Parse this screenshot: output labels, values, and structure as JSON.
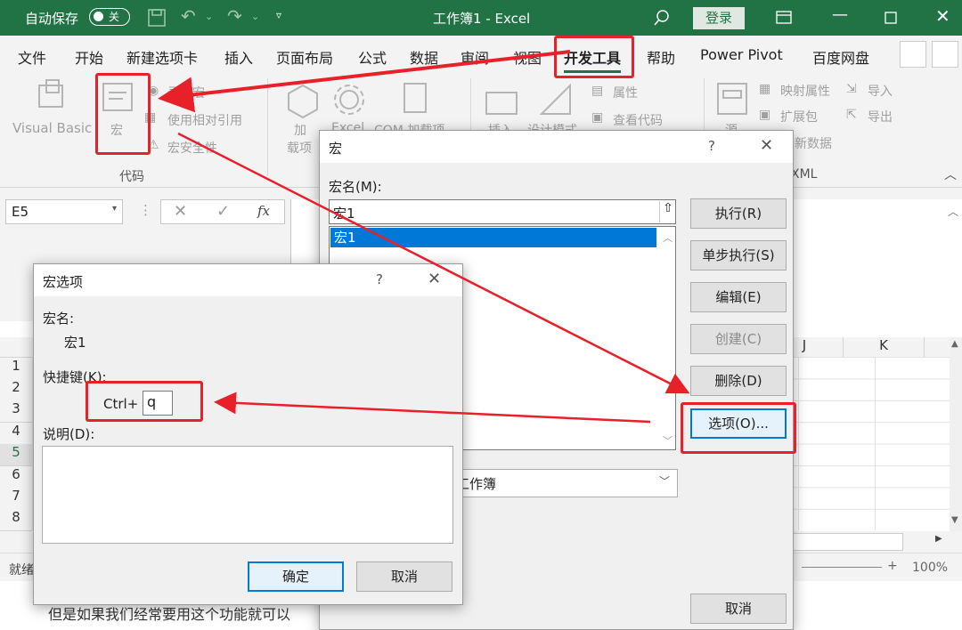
{
  "title_bar": {
    "autosave_label": "自动保存",
    "autosave_state": "关",
    "window_title": "工作簿1  -  Excel",
    "login_label": "登录"
  },
  "tabs": [
    "文件",
    "开始",
    "新建选项卡",
    "插入",
    "页面布局",
    "公式",
    "数据",
    "审阅",
    "视图",
    "开发工具",
    "帮助",
    "Power Pivot",
    "百度网盘"
  ],
  "active_tab": "开发工具",
  "ribbon": {
    "code_group": {
      "visual_basic": "Visual Basic",
      "macros": "宏",
      "record_macro": "录制宏",
      "relative_ref": "使用相对引用",
      "macro_security": "宏安全性",
      "group_label": "代码"
    },
    "addins": {
      "add": "加",
      "add2": "载项",
      "excel": "Excel",
      "com": "COM 加载项"
    },
    "controls": {
      "insert": "插入",
      "design": "设计模式",
      "properties": "属性",
      "view_code": "查看代码"
    },
    "xml": {
      "source": "源",
      "map_props": "映射属性",
      "expansion": "扩展包",
      "refresh": "新数据",
      "import": "导入",
      "export": "导出",
      "group_tail": "XML"
    }
  },
  "formula_bar": {
    "name_box": "E5",
    "fx": "fx"
  },
  "grid": {
    "rows": [
      "1",
      "2",
      "3",
      "4",
      "5",
      "6",
      "7",
      "8"
    ],
    "cols_visible": [
      "J",
      "K"
    ],
    "status_left": "就绪",
    "zoom": "100%"
  },
  "macro_dialog": {
    "title": "宏",
    "help": "?",
    "name_label": "宏名(M):",
    "name_value": "宏1",
    "list": [
      "宏1"
    ],
    "location_value": "工作簿",
    "buttons": {
      "run": "执行(R)",
      "step": "单步执行(S)",
      "edit": "编辑(E)",
      "create": "创建(C)",
      "delete": "删除(D)",
      "options": "选项(O)...",
      "cancel": "取消"
    }
  },
  "options_dialog": {
    "title": "宏选项",
    "help": "?",
    "name_label": "宏名:",
    "name_value": "宏1",
    "shortcut_label": "快捷键(K):",
    "shortcut_prefix": "Ctrl+",
    "shortcut_value": "q",
    "desc_label": "说明(D):",
    "ok": "确定",
    "cancel": "取消"
  },
  "caption_text": "但是如果我们经常要用这个功能就可以",
  "colors": {
    "excel_green": "#217346",
    "highlight_red": "#e8202a",
    "selection_blue": "#0078d7"
  }
}
